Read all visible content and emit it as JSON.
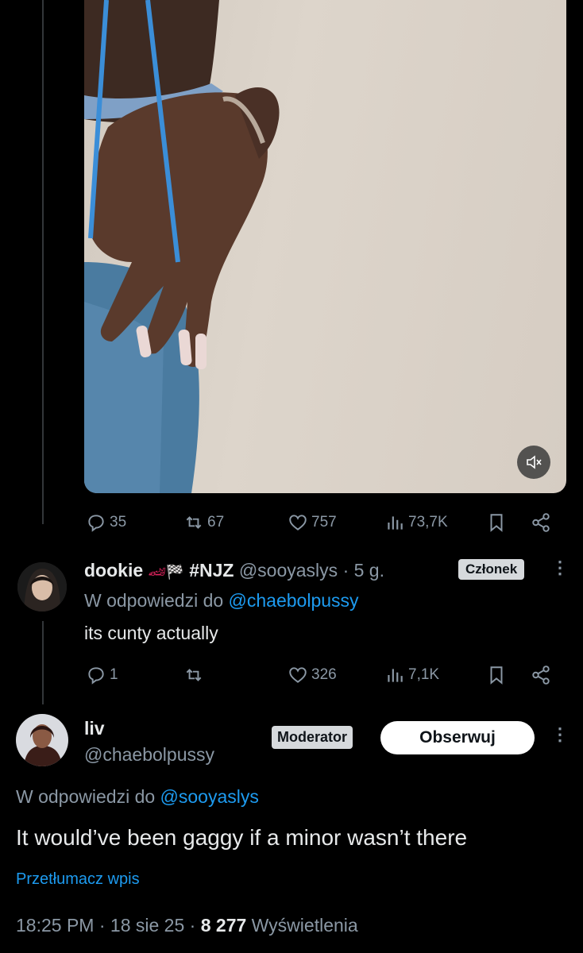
{
  "tweet1": {
    "actions": {
      "replies": "35",
      "reposts": "67",
      "likes": "757",
      "views": "73,7K"
    }
  },
  "reply1": {
    "name": "dookie",
    "name_suffix": "#NJZ",
    "handle": "@sooyaslys",
    "time": "· 5 g.",
    "badge": "Członek",
    "reply_prefix": "W odpowiedzi do",
    "reply_to": "@chaebolpussy",
    "text": "its cunty actually",
    "actions": {
      "replies": "1",
      "reposts": "",
      "likes": "326",
      "views": "7,1K"
    }
  },
  "main": {
    "name": "liv",
    "handle": "@chaebolpussy",
    "badge": "Moderator",
    "follow_label": "Obserwuj",
    "reply_prefix": "W odpowiedzi do",
    "reply_to": "@sooyaslys",
    "text": "It would’ve been gaggy if a minor wasn’t there",
    "translate": "Przetłumacz wpis",
    "time": "18:25 PM",
    "date": "18 sie 25",
    "views_count": "8 277",
    "views_label": "Wyświetlenia"
  },
  "colors": {
    "accent": "#1d9bf0",
    "muted": "#8b98a5",
    "background": "#000000"
  }
}
